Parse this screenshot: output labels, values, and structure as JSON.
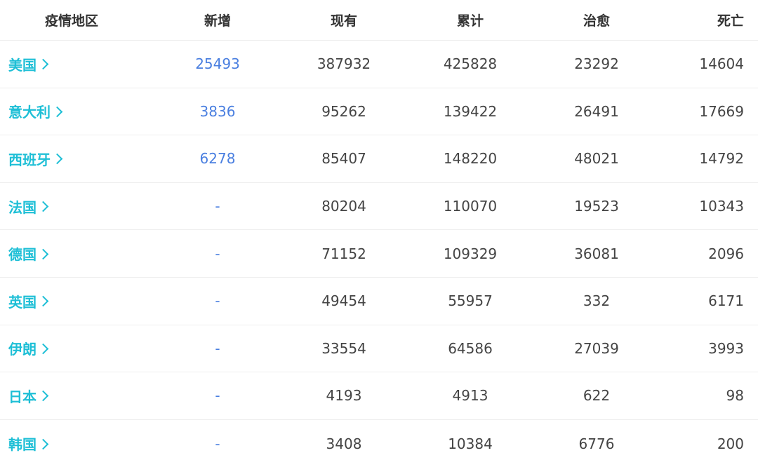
{
  "colors": {
    "region_link": "#1ebfd6",
    "new_value": "#4a7fe0",
    "text": "#444444",
    "header_text": "#333333",
    "divider": "#eeeeee"
  },
  "header": {
    "region": "疫情地区",
    "new": "新增",
    "current": "现有",
    "total": "累计",
    "cured": "治愈",
    "dead": "死亡"
  },
  "rows": [
    {
      "region": "美国",
      "new": "25493",
      "current": "387932",
      "total": "425828",
      "cured": "23292",
      "dead": "14604"
    },
    {
      "region": "意大利",
      "new": "3836",
      "current": "95262",
      "total": "139422",
      "cured": "26491",
      "dead": "17669"
    },
    {
      "region": "西班牙",
      "new": "6278",
      "current": "85407",
      "total": "148220",
      "cured": "48021",
      "dead": "14792"
    },
    {
      "region": "法国",
      "new": "-",
      "current": "80204",
      "total": "110070",
      "cured": "19523",
      "dead": "10343"
    },
    {
      "region": "德国",
      "new": "-",
      "current": "71152",
      "total": "109329",
      "cured": "36081",
      "dead": "2096"
    },
    {
      "region": "英国",
      "new": "-",
      "current": "49454",
      "total": "55957",
      "cured": "332",
      "dead": "6171"
    },
    {
      "region": "伊朗",
      "new": "-",
      "current": "33554",
      "total": "64586",
      "cured": "27039",
      "dead": "3993"
    },
    {
      "region": "日本",
      "new": "-",
      "current": "4193",
      "total": "4913",
      "cured": "622",
      "dead": "98"
    },
    {
      "region": "韩国",
      "new": "-",
      "current": "3408",
      "total": "10384",
      "cured": "6776",
      "dead": "200"
    }
  ]
}
